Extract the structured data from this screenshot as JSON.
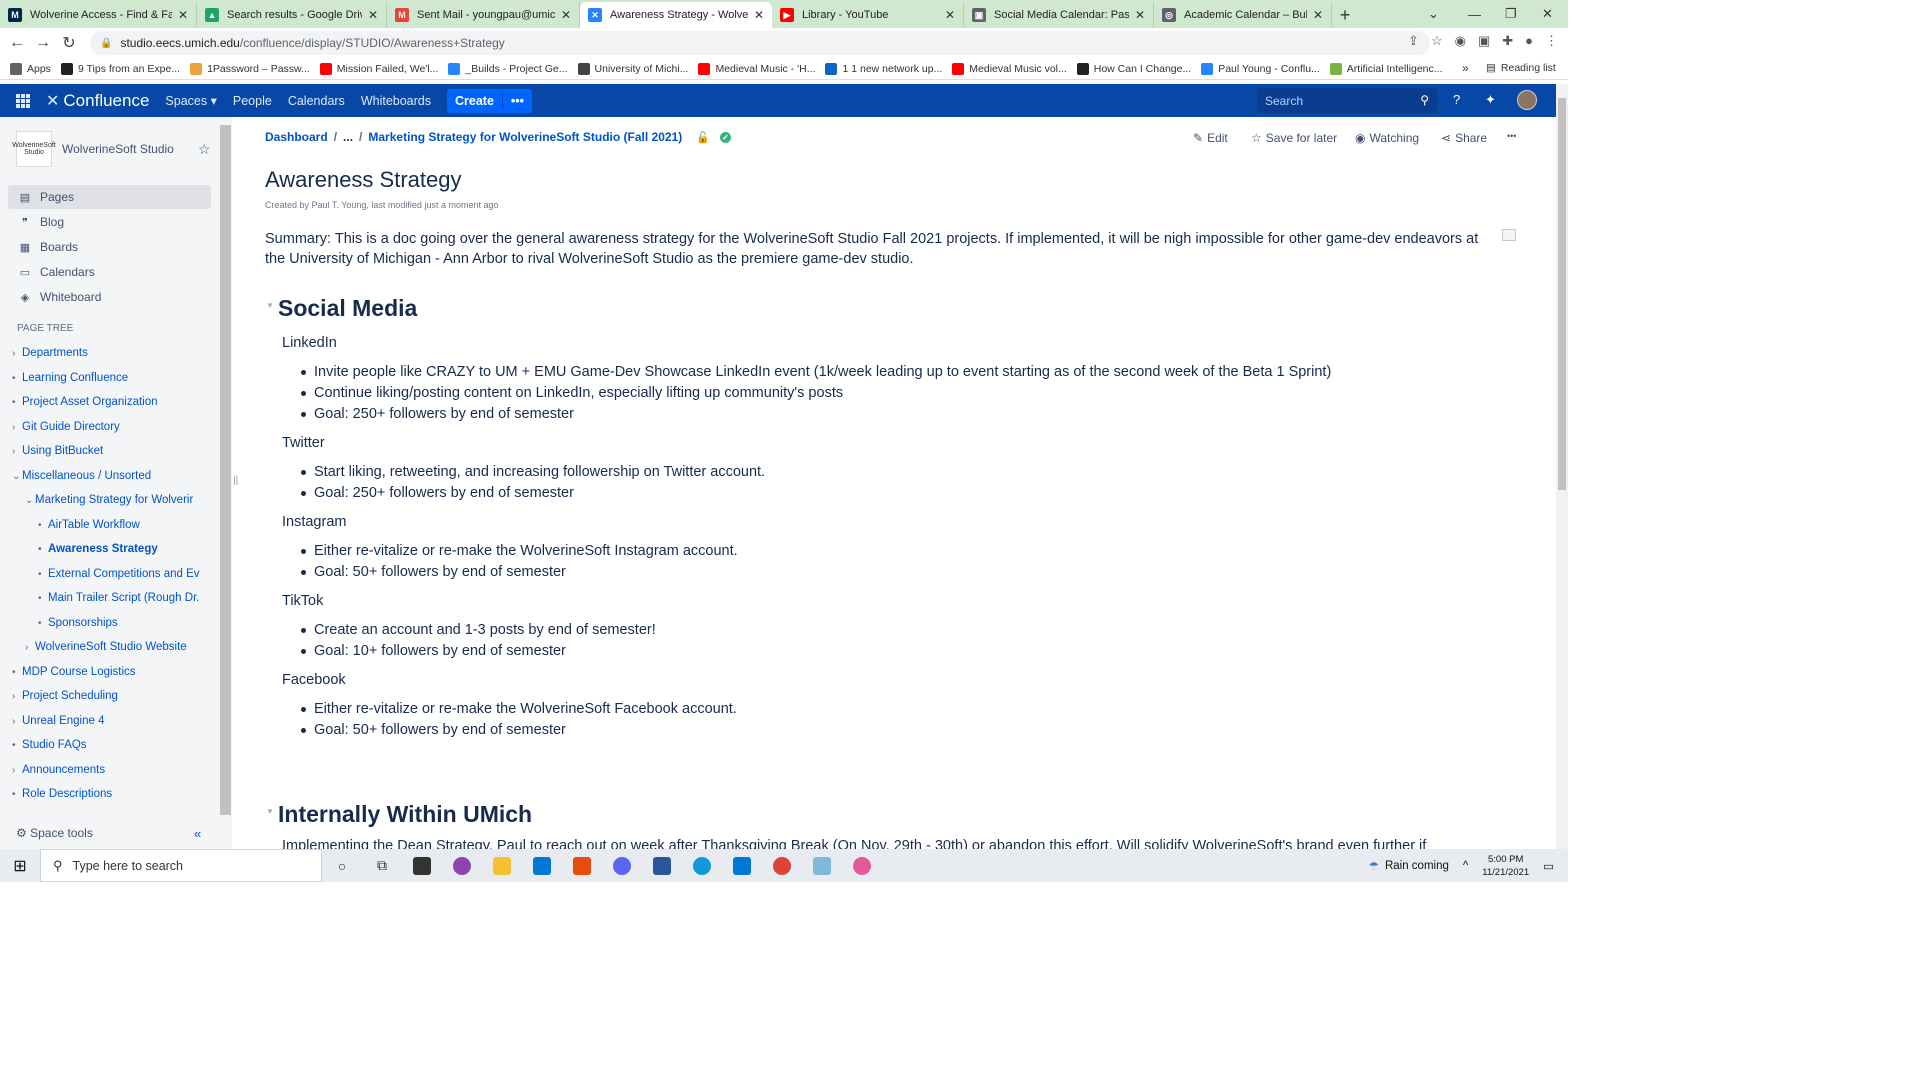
{
  "browser": {
    "tabs": [
      {
        "label": "Wolverine Access - Find & Favor",
        "color": "#00274c",
        "glyph": "M"
      },
      {
        "label": "Search results - Google Drive",
        "color": "#1fa463",
        "glyph": "▲"
      },
      {
        "label": "Sent Mail - youngpau@umich.e",
        "color": "#ea4335",
        "glyph": "M"
      },
      {
        "label": "Awareness Strategy - Wolverine",
        "color": "#2684ff",
        "glyph": "✕"
      },
      {
        "label": "Library - YouTube",
        "color": "#ff0000",
        "glyph": "▶"
      },
      {
        "label": "Social Media Calendar: Passwor",
        "color": "#5f6368",
        "glyph": "▣"
      },
      {
        "label": "Academic Calendar – Bulletin",
        "color": "#5f6368",
        "glyph": "◎"
      }
    ],
    "url_host": "studio.eecs.umich.edu",
    "url_path": "/confluence/display/STUDIO/Awareness+Strategy",
    "bookmarks": [
      {
        "label": "Apps",
        "color": "#5f6368"
      },
      {
        "label": "9 Tips from an Expe...",
        "color": "#222"
      },
      {
        "label": "1Password – Passw...",
        "color": "#e8a33d"
      },
      {
        "label": "Mission Failed, We'l...",
        "color": "#ff0000"
      },
      {
        "label": "_Builds - Project Ge...",
        "color": "#2684ff"
      },
      {
        "label": "University of Michi...",
        "color": "#444"
      },
      {
        "label": "Medieval Music - 'H...",
        "color": "#ff0000"
      },
      {
        "label": "1 1 new network up...",
        "color": "#0a66c2"
      },
      {
        "label": "Medieval Music vol...",
        "color": "#ff0000"
      },
      {
        "label": "How Can I Change...",
        "color": "#222"
      },
      {
        "label": "Paul Young - Conflu...",
        "color": "#2684ff"
      },
      {
        "label": "Artificial Intelligenc...",
        "color": "#7cb342"
      }
    ],
    "reading_list": "Reading list"
  },
  "confluence": {
    "logo": "Confluence",
    "nav": {
      "spaces": "Spaces",
      "people": "People",
      "calendars": "Calendars",
      "whiteboards": "Whiteboards",
      "create": "Create"
    },
    "search_placeholder": "Search"
  },
  "sidebar": {
    "space_name": "WolverineSoft Studio",
    "space_logo_text": "WolverineSoft Studio",
    "nav": [
      {
        "label": "Pages",
        "icon": "pages-icon",
        "glyph": "▤"
      },
      {
        "label": "Blog",
        "icon": "quote-icon",
        "glyph": "❞"
      },
      {
        "label": "Boards",
        "icon": "boards-icon",
        "glyph": "▦"
      },
      {
        "label": "Calendars",
        "icon": "calendar-icon",
        "glyph": "▭"
      },
      {
        "label": "Whiteboard",
        "icon": "whiteboard-icon",
        "glyph": "◈"
      }
    ],
    "page_tree_label": "PAGE TREE",
    "tree": [
      {
        "label": "Departments",
        "marker": "›",
        "indent": 0
      },
      {
        "label": "Learning Confluence",
        "marker": "•",
        "indent": 0
      },
      {
        "label": "Project Asset Organization",
        "marker": "•",
        "indent": 0
      },
      {
        "label": "Git Guide Directory",
        "marker": "›",
        "indent": 0
      },
      {
        "label": "Using BitBucket",
        "marker": "›",
        "indent": 0
      },
      {
        "label": "Miscellaneous / Unsorted",
        "marker": "⌄",
        "indent": 0
      },
      {
        "label": "Marketing Strategy for Wolverir",
        "marker": "⌄",
        "indent": 1
      },
      {
        "label": "AirTable Workflow",
        "marker": "•",
        "indent": 2
      },
      {
        "label": "Awareness Strategy",
        "marker": "•",
        "indent": 2,
        "current": true
      },
      {
        "label": "External Competitions and Ev",
        "marker": "•",
        "indent": 2
      },
      {
        "label": "Main Trailer Script (Rough Dr.",
        "marker": "•",
        "indent": 2
      },
      {
        "label": "Sponsorships",
        "marker": "•",
        "indent": 2
      },
      {
        "label": "WolverineSoft Studio Website",
        "marker": "›",
        "indent": 1
      },
      {
        "label": "MDP Course Logistics",
        "marker": "•",
        "indent": 0
      },
      {
        "label": "Project Scheduling",
        "marker": "›",
        "indent": 0
      },
      {
        "label": "Unreal Engine 4",
        "marker": "›",
        "indent": 0
      },
      {
        "label": "Studio FAQs",
        "marker": "•",
        "indent": 0
      },
      {
        "label": "Announcements",
        "marker": "›",
        "indent": 0
      },
      {
        "label": "Role Descriptions",
        "marker": "•",
        "indent": 0
      }
    ],
    "space_tools": "Space tools"
  },
  "page": {
    "breadcrumb": {
      "dashboard": "Dashboard",
      "ellipsis": "...",
      "parent": "Marketing Strategy for WolverineSoft Studio (Fall 2021)"
    },
    "actions": {
      "edit": "Edit",
      "save": "Save for later",
      "watching": "Watching",
      "share": "Share",
      "more": "•••"
    },
    "title": "Awareness Strategy",
    "byline": "Created by Paul T. Young, last modified just a moment ago",
    "summary": "Summary: This is a doc going over the general awareness strategy for the WolverineSoft Studio Fall 2021 projects. If implemented, it will be nigh impossible for other game-dev endeavors at the University of Michigan - Ann Arbor to rival WolverineSoft Studio as the premiere game-dev studio.",
    "section1": "Social Media",
    "groups": [
      {
        "name": "LinkedIn",
        "items": [
          "Invite people like CRAZY to UM + EMU Game-Dev Showcase LinkedIn event (1k/week leading up to event starting as of the second week of the Beta 1 Sprint)",
          "Continue liking/posting content on LinkedIn, especially lifting up community's posts",
          "Goal: 250+ followers by end of semester"
        ]
      },
      {
        "name": "Twitter",
        "items": [
          "Start liking, retweeting, and increasing followership on Twitter account.",
          "Goal: 250+ followers by end of semester"
        ]
      },
      {
        "name": "Instagram",
        "items": [
          "Either re-vitalize or re-make the WolverineSoft Instagram account.",
          "Goal: 50+ followers by end of semester"
        ]
      },
      {
        "name": "TikTok",
        "items": [
          "Create an account and 1-3 posts by end of semester!",
          "Goal: 10+ followers by end of semester"
        ]
      },
      {
        "name": "Facebook",
        "items": [
          "Either re-vitalize or re-make the WolverineSoft Facebook account.",
          "Goal: 50+ followers by end of semester"
        ]
      }
    ],
    "section2": "Internally Within UMich",
    "section2_text": "Implementing the Dean Strategy, Paul to reach out on week after Thanksgiving Break (On Nov. 29th - 30th) or abandon this effort. Will solidify WolverineSoft's brand even further if"
  },
  "taskbar": {
    "search_placeholder": "Type here to search",
    "weather": "Rain coming",
    "time": "5:00 PM",
    "date": "11/21/2021"
  }
}
